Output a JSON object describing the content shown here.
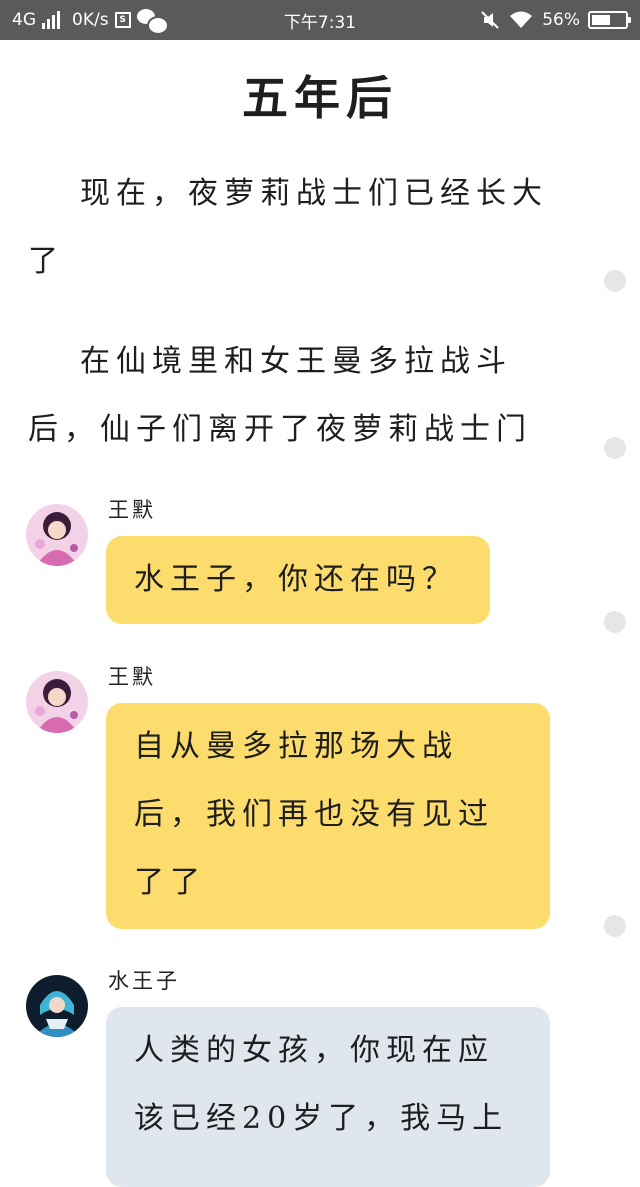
{
  "status_bar": {
    "network": "4G",
    "speed": "0K/s",
    "time": "下午7:31",
    "battery": "56%",
    "battery_level": 0.56,
    "icons": [
      "signal-icon",
      "notification-icon",
      "wechat-icon",
      "mute-icon",
      "wifi-icon",
      "battery-icon"
    ]
  },
  "title": "五年后",
  "paragraphs": [
    "现在，夜萝莉战士们已经长大了",
    "在仙境里和女王曼多拉战斗后，仙子们离开了夜萝莉战士门"
  ],
  "messages": [
    {
      "sender": "王默",
      "text": "水王子，你还在吗？",
      "style": "yellow"
    },
    {
      "sender": "王默",
      "text": "自从曼多拉那场大战后，我们再也没有见过了了",
      "style": "yellow"
    },
    {
      "sender": "水王子",
      "text": "人类的女孩，你现在应该已经20岁了，我马上",
      "style": "gray"
    }
  ],
  "colors": {
    "status_bar": "#5a5a5a",
    "bubble_yellow": "#fcdc6c",
    "bubble_gray": "#dfe6ee"
  }
}
